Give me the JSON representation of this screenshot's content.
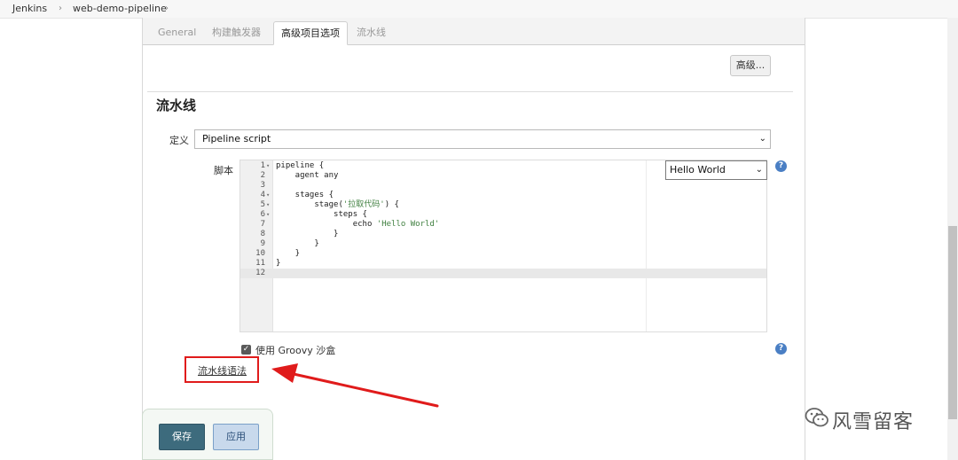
{
  "breadcrumb": {
    "items": [
      "Jenkins",
      "web-demo-pipeline"
    ],
    "separator": "›"
  },
  "tabs": [
    {
      "label": "General",
      "active": false
    },
    {
      "label": "构建触发器",
      "active": false
    },
    {
      "label": "高级项目选项",
      "active": true
    },
    {
      "label": "流水线",
      "active": false
    }
  ],
  "advanced_button": "高级...",
  "section_title": "流水线",
  "definition": {
    "label": "定义",
    "selected": "Pipeline script",
    "arrow": "⌄"
  },
  "script": {
    "label": "脚本",
    "lines": [
      {
        "n": "1",
        "fold": "▾",
        "code": "pipeline {"
      },
      {
        "n": "2",
        "fold": "",
        "code": "    agent any"
      },
      {
        "n": "3",
        "fold": "",
        "code": ""
      },
      {
        "n": "4",
        "fold": "▾",
        "code": "    stages {"
      },
      {
        "n": "5",
        "fold": "▾",
        "code": "        stage('拉取代码') {"
      },
      {
        "n": "6",
        "fold": "▾",
        "code": "            steps {"
      },
      {
        "n": "7",
        "fold": "",
        "code": "                echo 'Hello World'"
      },
      {
        "n": "8",
        "fold": "",
        "code": "            }"
      },
      {
        "n": "9",
        "fold": "",
        "code": "        }"
      },
      {
        "n": "10",
        "fold": "",
        "code": "    }"
      },
      {
        "n": "11",
        "fold": "",
        "code": "}"
      },
      {
        "n": "12",
        "fold": "",
        "code": ""
      }
    ],
    "current_line": 12
  },
  "sample_select": {
    "selected": "Hello World",
    "arrow": "⌄"
  },
  "help_icon": "?",
  "sandbox": {
    "label": "使用 Groovy 沙盒",
    "checked": true,
    "check_mark": "✓"
  },
  "syntax_link": "流水线语法",
  "buttons": {
    "save": "保存",
    "apply": "应用"
  },
  "watermark": {
    "text": "风雪留客",
    "icon": "wechat-icon"
  },
  "colors": {
    "annotation_red": "#e01b1b",
    "save_button": "#3d6b7d",
    "apply_button": "#c8d9ec"
  }
}
